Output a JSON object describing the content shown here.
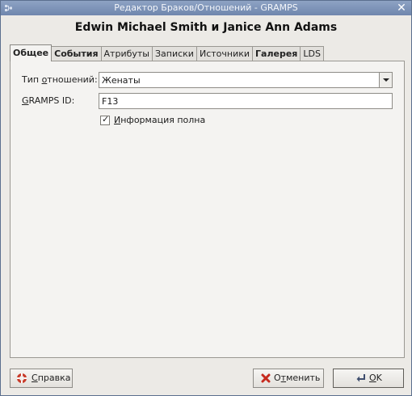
{
  "window": {
    "title": "Редактор Браков/Отношений - GRAMPS",
    "close_glyph": "✕"
  },
  "heading": "Edwin Michael Smith и Janice Ann Adams",
  "tabs": [
    {
      "label": "Общее",
      "active": true
    },
    {
      "label": "События",
      "bold": true
    },
    {
      "label": "Атрибуты"
    },
    {
      "label": "Записки"
    },
    {
      "label": "Источники"
    },
    {
      "label": "Галерея",
      "bold": true
    },
    {
      "label": "LDS"
    }
  ],
  "form": {
    "rel_type_label_pre": "Тип ",
    "rel_type_label_u": "о",
    "rel_type_label_post": "тношений:",
    "rel_type_value": "Женаты",
    "gramps_id_label_u": "G",
    "gramps_id_label_post": "RAMPS ID:",
    "gramps_id_value": "F13",
    "complete_checked": true,
    "complete_check_glyph": "✓",
    "complete_label_u": "И",
    "complete_label_post": "нформация полна"
  },
  "buttons": {
    "help_u": "С",
    "help_post": "правка",
    "cancel_pre": "О",
    "cancel_u": "т",
    "cancel_post": "менить",
    "ok_u": "O",
    "ok_post": "K"
  },
  "icons": {
    "app": "gramps-app-icon",
    "help": "lifebuoy-help-icon",
    "cancel": "red-x-cancel-icon",
    "ok": "return-arrow-ok-icon"
  },
  "colors": {
    "titlebar": "#7f95ba",
    "cancel_x": "#c62a1e",
    "help_red": "#c83b2a"
  }
}
